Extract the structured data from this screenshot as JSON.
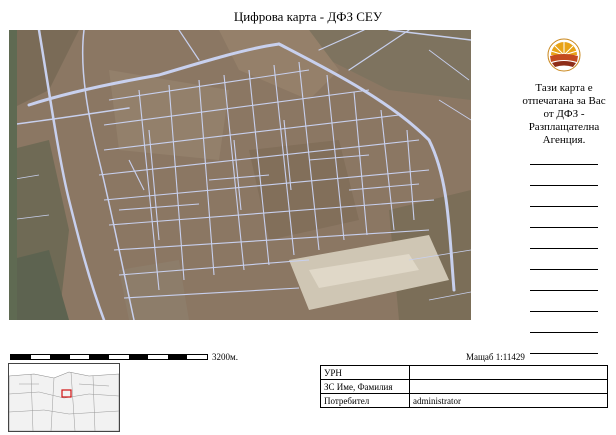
{
  "title": "Цифрова карта - ДФЗ СЕУ",
  "side_text": "Тази карта е отпечатана за Вас от ДФЗ - Разплащателна Агенция.",
  "scale": {
    "distance_label": "3200м.",
    "ratio_label": "Мащаб 1:11429"
  },
  "info_table": [
    {
      "key": "УРН",
      "value": ""
    },
    {
      "key": "ЗС Име, Фамилия",
      "value": ""
    },
    {
      "key": "Потребител",
      "value": "administrator"
    }
  ],
  "colors": {
    "parcel_boundary": "#c8d0ee",
    "field": "#8a7560",
    "logo_sun": "#e8a317",
    "logo_field": "#a5391f"
  },
  "icons": [
    "dfz-logo-icon"
  ]
}
